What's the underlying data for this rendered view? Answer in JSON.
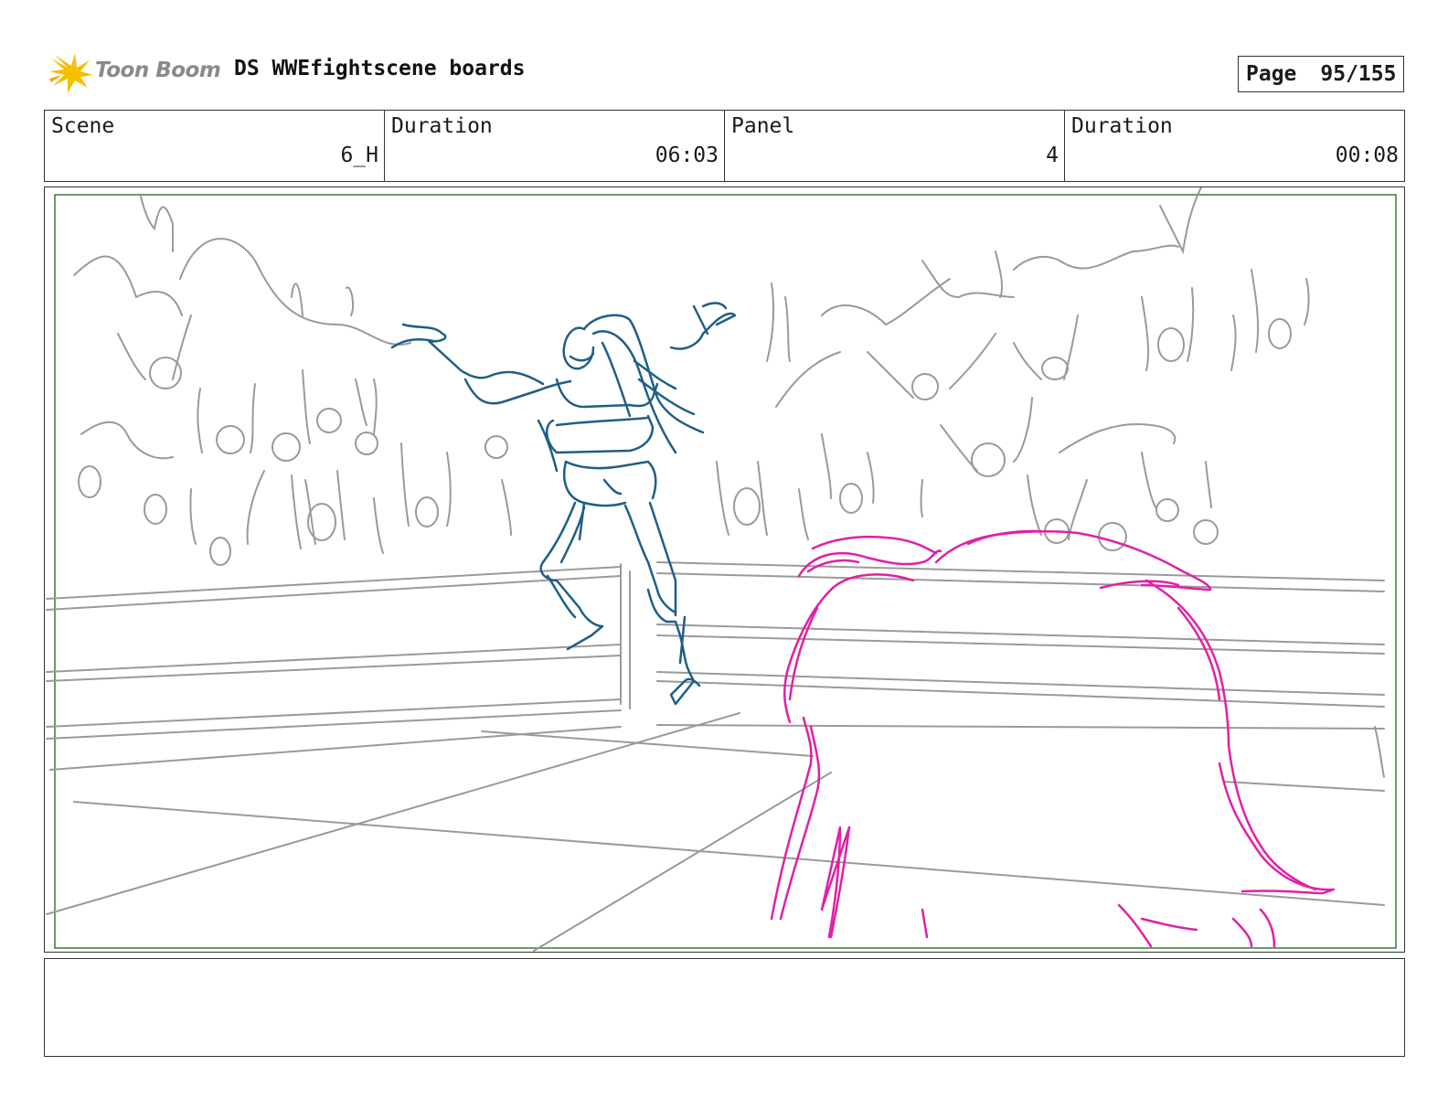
{
  "header": {
    "logo_text": "Toon Boom",
    "project_title": "DS WWEfightscene boards",
    "page_label": "Page",
    "page_number": "95/155"
  },
  "info": {
    "scene_label": "Scene",
    "scene_value": "6_H",
    "scene_duration_label": "Duration",
    "scene_duration_value": "06:03",
    "panel_label": "Panel",
    "panel_value": "4",
    "panel_duration_label": "Duration",
    "panel_duration_value": "00:08"
  },
  "colors": {
    "safe_frame": "#3a7a3a",
    "crowd_sketch": "#9a9a9a",
    "wrestler_sketch": "#1f5f86",
    "foreground_sketch": "#e020a8",
    "logo_star": "#f5c000"
  },
  "notes": {
    "action_text": ""
  }
}
